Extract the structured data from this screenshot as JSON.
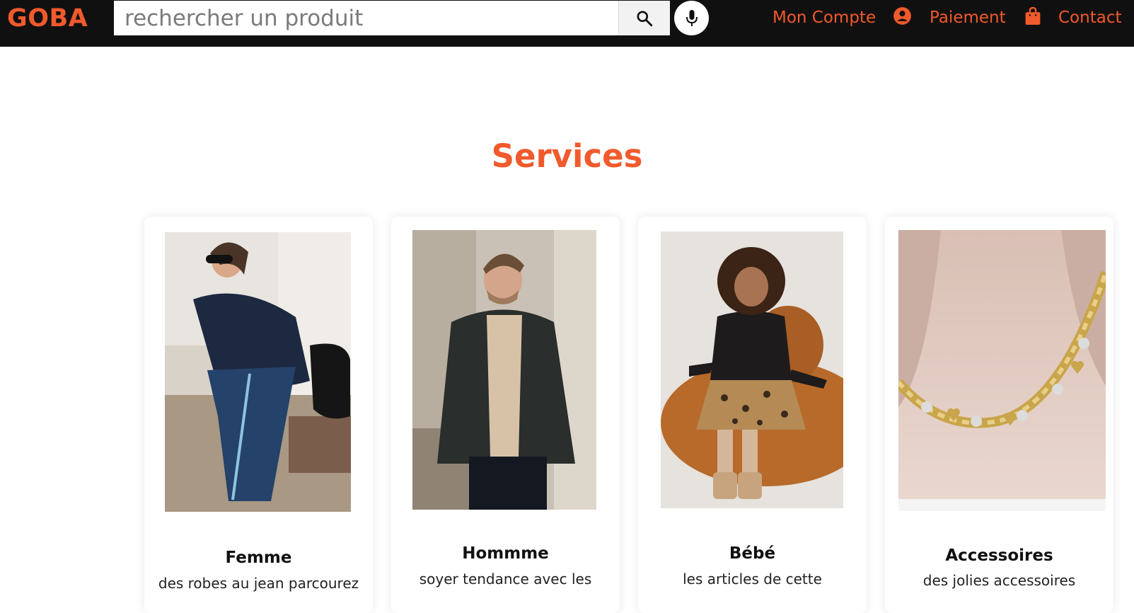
{
  "brand": {
    "logo": "GOBA",
    "accent_color": "#f15a2c",
    "navbar_color": "#111010"
  },
  "search": {
    "placeholder": "rechercher un produit",
    "button_icon": "search-icon",
    "voice_icon": "microphone-icon"
  },
  "nav": {
    "account_label": "Mon Compte",
    "account_icon": "user-circle-icon",
    "payment_label": "Paiement",
    "payment_icon": "shopping-bag-icon",
    "contact_label": "Contact"
  },
  "services": {
    "title": "Services",
    "cards": [
      {
        "title": "Femme",
        "description": "des robes au jean parcourez",
        "image": "woman-in-navy-outfit-photo"
      },
      {
        "title": "Hommme",
        "description": "soyer tendance avec les",
        "image": "man-in-quilted-jacket-photo"
      },
      {
        "title": "Bébé",
        "description": "les articles de cette",
        "image": "child-in-leopard-skirt-photo"
      },
      {
        "title": "Accessoires",
        "description": "des jolies accessoires",
        "image": "gold-necklace-photo"
      }
    ]
  }
}
